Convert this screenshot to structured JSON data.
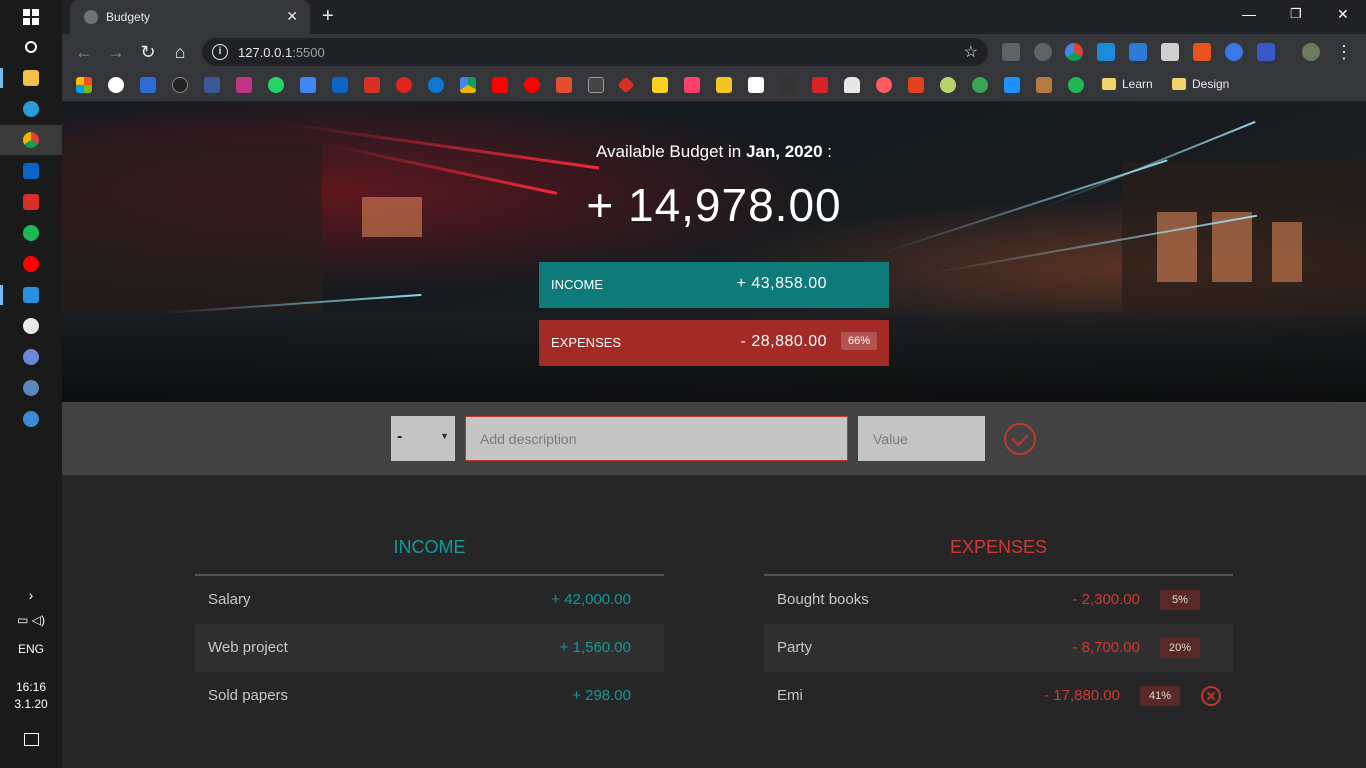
{
  "browser": {
    "tab_title": "Budgety",
    "url_host": "127.0.0.1",
    "url_port": ":5500",
    "bookmark_folders": [
      "Learn",
      "Design"
    ]
  },
  "taskbar": {
    "language": "ENG",
    "time": "16:16",
    "date": "3.1.20"
  },
  "budget": {
    "title_prefix": "Available Budget in ",
    "month": "Jan, 2020",
    "title_suffix": " :",
    "value": "+ 14,978.00",
    "income_label": "INCOME",
    "income_value": "+ 43,858.00",
    "expenses_label": "EXPENSES",
    "expenses_value": "- 28,880.00",
    "expenses_percentage": "66%"
  },
  "form": {
    "type_value": "-",
    "description_placeholder": "Add description",
    "value_placeholder": "Value"
  },
  "income": {
    "title": "INCOME",
    "items": [
      {
        "description": "Salary",
        "value": "+ 42,000.00"
      },
      {
        "description": "Web project",
        "value": "+ 1,560.00"
      },
      {
        "description": "Sold papers",
        "value": "+ 298.00"
      }
    ]
  },
  "expenses": {
    "title": "EXPENSES",
    "items": [
      {
        "description": "Bought books",
        "value": "- 2,300.00",
        "percentage": "5%"
      },
      {
        "description": "Party",
        "value": "- 8,700.00",
        "percentage": "20%"
      },
      {
        "description": "Emi",
        "value": "- 17,880.00",
        "percentage": "41%"
      }
    ]
  },
  "colors": {
    "income_accent": "#139a9a",
    "expense_accent": "#d13a32",
    "income_box": "#0e7a7a",
    "expense_box": "#a22a27"
  }
}
